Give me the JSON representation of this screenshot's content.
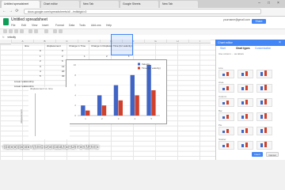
{
  "browser": {
    "tabs": [
      "Untitled spreadsheet",
      "Chart editor",
      "New Tab",
      "Google Sheets",
      "New Tab"
    ],
    "url": "docs.google.com/spreadsheets/d/.../edit#gid=0",
    "window_controls": [
      "–",
      "□",
      "×"
    ],
    "nav": [
      "←",
      "→",
      "⟳"
    ]
  },
  "sheet": {
    "title": "Untitled spreadsheet",
    "account": "yourname@gmail.com",
    "share_label": "Share",
    "menu": [
      "File",
      "Edit",
      "View",
      "Insert",
      "Format",
      "Data",
      "Tools",
      "Add-ons",
      "Help"
    ],
    "formula_ref": "velocity",
    "columns": [
      "A",
      "B",
      "C",
      "D",
      "E",
      "F",
      "G",
      "H",
      "I"
    ],
    "table": {
      "headers": [
        "time",
        "displacement",
        "Change in Time",
        "Change in Displacement",
        "Time (for velocity)"
      ],
      "rows": [
        [
          "0",
          "0",
          "",
          "",
          ""
        ],
        [
          "1",
          "2",
          "1",
          "2",
          "1"
        ],
        [
          "2",
          "6",
          "1",
          "4",
          "2"
        ],
        [
          "3",
          "12",
          "1",
          "6",
          "3"
        ],
        [
          "4",
          "20",
          "1",
          "8",
          "4"
        ],
        [
          "5",
          "30",
          "1",
          "10",
          "5"
        ]
      ]
    },
    "notes": [
      "Linear relationship",
      "Linear relationship"
    ],
    "second_chart_title": "displacement vs. time",
    "second_chart_ylabel": "displacement"
  },
  "chart_data": {
    "type": "bar",
    "categories": [
      "1",
      "2",
      "3",
      "4",
      "5"
    ],
    "series": [
      {
        "name": "Velocity",
        "values": [
          2,
          4,
          6,
          8,
          10
        ],
        "color": "#3f64c4"
      },
      {
        "name": "Time (for velocity)",
        "values": [
          1,
          2,
          3,
          4,
          5
        ],
        "color": "#d0412d"
      }
    ],
    "ylim": [
      0,
      10
    ],
    "legend": "top-right"
  },
  "panel": {
    "title": "Chart editor",
    "tabs": [
      "Start",
      "Chart types",
      "Customization"
    ],
    "sections": [
      "Line",
      "Area",
      "Column",
      "Bar",
      "Pie",
      "Scatter"
    ],
    "subtitle": "Use column ... as labels",
    "footer": [
      "Insert",
      "Cancel"
    ]
  },
  "colors": {
    "accent": "#4285f4",
    "sheets_green": "#0f9d58",
    "series1": "#3f64c4",
    "series2": "#d0412d"
  },
  "watermark": "RECORDED WITH SCREENCAST-O-MATIC"
}
